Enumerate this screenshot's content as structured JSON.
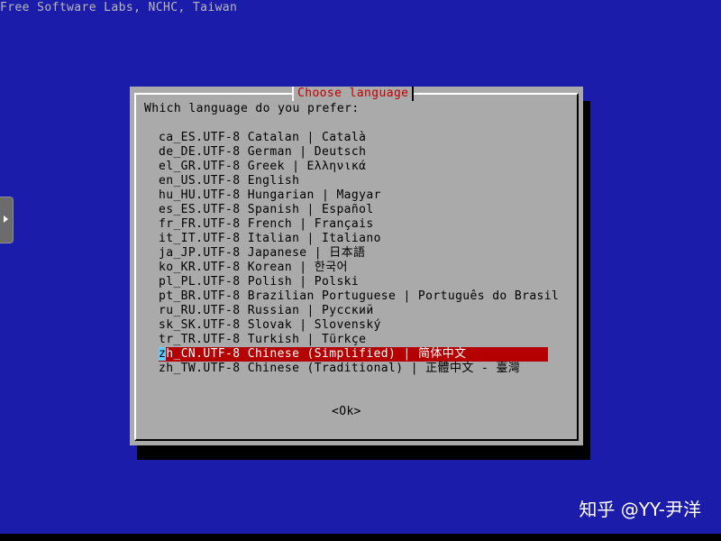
{
  "backtitle": "Free Software Labs, NCHC, Taiwan",
  "dialog": {
    "title": "Choose language",
    "prompt": "Which language do you prefer:",
    "items": [
      {
        "text": "ca_ES.UTF-8 Catalan | Català",
        "selected": false
      },
      {
        "text": "de_DE.UTF-8 German | Deutsch",
        "selected": false
      },
      {
        "text": "el_GR.UTF-8 Greek | Ελληνικά",
        "selected": false
      },
      {
        "text": "en_US.UTF-8 English",
        "selected": false
      },
      {
        "text": "hu_HU.UTF-8 Hungarian | Magyar",
        "selected": false
      },
      {
        "text": "es_ES.UTF-8 Spanish | Español",
        "selected": false
      },
      {
        "text": "fr_FR.UTF-8 French | Français",
        "selected": false
      },
      {
        "text": "it_IT.UTF-8 Italian | Italiano",
        "selected": false
      },
      {
        "text": "ja_JP.UTF-8 Japanese | 日本語",
        "selected": false
      },
      {
        "text": "ko_KR.UTF-8 Korean | 한국어",
        "selected": false
      },
      {
        "text": "pl_PL.UTF-8 Polish | Polski",
        "selected": false
      },
      {
        "text": "pt_BR.UTF-8 Brazilian Portuguese | Português do Brasil",
        "selected": false
      },
      {
        "text": "ru_RU.UTF-8 Russian | Русский",
        "selected": false
      },
      {
        "text": "sk_SK.UTF-8 Slovak | Slovenský",
        "selected": false
      },
      {
        "text": "tr_TR.UTF-8 Turkish | Türkçe",
        "selected": false
      },
      {
        "text": "zh_CN.UTF-8 Chinese (Simplified) | 简体中文",
        "selected": true
      },
      {
        "text": "zh_TW.UTF-8 Chinese (Traditional) | 正體中文 - 臺灣",
        "selected": false
      }
    ],
    "ok_label": "<Ok>"
  },
  "side_tab": {
    "icon": "arrow-right-icon"
  },
  "watermark": "知乎 @YY-尹洋",
  "colors": {
    "background": "#1c1caa",
    "dialog": "#aaaaaa",
    "title_text": "#c00000",
    "selection": "#b40000",
    "cursor": "#66ccff"
  }
}
